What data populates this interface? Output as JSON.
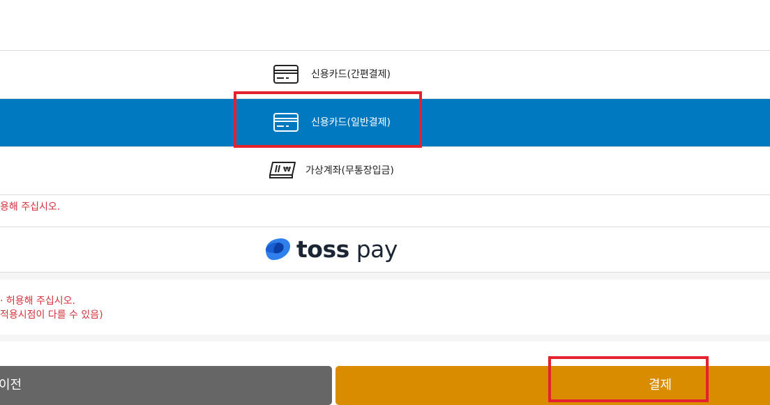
{
  "payment_methods": [
    {
      "label": "신용카드(간편결제)",
      "icon": "credit-card-icon",
      "selected": false
    },
    {
      "label": "신용카드(일반결제)",
      "icon": "credit-card-icon",
      "selected": true
    },
    {
      "label": "가상계좌(무통장입금)",
      "icon": "virtual-account-icon",
      "selected": false
    }
  ],
  "popup_notice": "용해 주십시오.",
  "toss_pay": {
    "brand_bold": "toss",
    "brand_light": "pay",
    "icon": "toss-logo-icon"
  },
  "toss_notice_lines": [
    "· 허용해 주십시오.",
    "적용시점이 다를 수 있음)"
  ],
  "buttons": {
    "prev_label": "이전",
    "pay_label": "결제"
  },
  "colors": {
    "selected_bg": "#0079c1",
    "notice_text": "#d6303a",
    "prev_button": "#666666",
    "pay_button": "#d98c00",
    "highlight": "#e3222e"
  }
}
